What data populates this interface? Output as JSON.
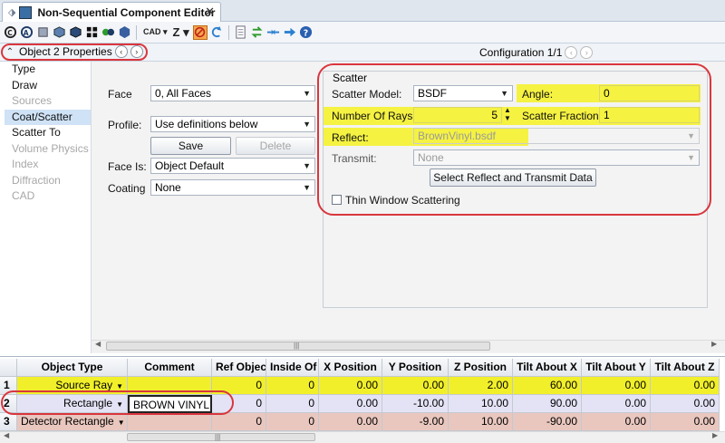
{
  "window": {
    "tab_title": "Non-Sequential Component Editor",
    "close_glyph": "✕",
    "pin_glyph": "⬗"
  },
  "toolbar": {
    "items": [
      "refresh-icon",
      "layout-icon",
      "object-icon",
      "cube-icon",
      "cube-dark-icon",
      "grid-icon",
      "sphere-icon",
      "hexagon-icon"
    ],
    "cad_label": "CAD",
    "z_label": "Z",
    "colors": {
      "accent": "#1d3a66",
      "stop": "#e8731a",
      "arrow": "#2a7fd0",
      "green": "#2e9b2e"
    }
  },
  "properties": {
    "title": "Object 2 Properties",
    "configuration": "Configuration 1/1"
  },
  "nav": {
    "items": [
      {
        "label": "Type",
        "state": "normal"
      },
      {
        "label": "Draw",
        "state": "normal"
      },
      {
        "label": "Sources",
        "state": "disabled"
      },
      {
        "label": "Coat/Scatter",
        "state": "selected"
      },
      {
        "label": "Scatter To",
        "state": "normal"
      },
      {
        "label": "Volume Physics",
        "state": "disabled"
      },
      {
        "label": "Index",
        "state": "disabled"
      },
      {
        "label": "Diffraction",
        "state": "disabled"
      },
      {
        "label": "CAD",
        "state": "disabled"
      }
    ]
  },
  "form": {
    "face_label": "Face",
    "face_value": "0, All Faces",
    "profile_label": "Profile:",
    "profile_value": "Use definitions below",
    "save_label": "Save",
    "delete_label": "Delete",
    "face_is_label": "Face Is:",
    "face_is_value": "Object Default",
    "coating_label": "Coating",
    "coating_value": "None"
  },
  "scatter": {
    "group_title": "Scatter",
    "model_label": "Scatter Model:",
    "model_value": "BSDF",
    "angle_label": "Angle:",
    "angle_value": "0",
    "rays_label": "Number Of Rays:",
    "rays_value": "5",
    "fraction_label": "Scatter Fraction",
    "fraction_value": "1",
    "reflect_label": "Reflect:",
    "reflect_value": "BrownVinyl.bsdf",
    "transmit_label": "Transmit:",
    "transmit_value": "None",
    "select_data_label": "Select Reflect and Transmit Data",
    "thin_window_label": "Thin Window Scattering",
    "thin_window_checked": false,
    "highlight_color": "#f5f242"
  },
  "grid": {
    "headers": [
      "Object Type",
      "Comment",
      "Ref Object",
      "Inside Of",
      "X Position",
      "Y Position",
      "Z Position",
      "Tilt About X",
      "Tilt About Y",
      "Tilt About Z"
    ],
    "rows": [
      {
        "num": "1",
        "type": "Source Ray",
        "comment": "",
        "ref": "0",
        "inside": "0",
        "x": "0.00",
        "y": "0.00",
        "z": "2.00",
        "tx": "60.00",
        "ty": "0.00",
        "tz": "0.00"
      },
      {
        "num": "2",
        "type": "Rectangle",
        "comment": "BROWN VINYL...",
        "ref": "0",
        "inside": "0",
        "x": "0.00",
        "y": "-10.00",
        "z": "10.00",
        "tx": "90.00",
        "ty": "0.00",
        "tz": "0.00"
      },
      {
        "num": "3",
        "type": "Detector Rectangle",
        "comment": "",
        "ref": "0",
        "inside": "0",
        "x": "0.00",
        "y": "-9.00",
        "z": "10.00",
        "tx": "-90.00",
        "ty": "0.00",
        "tz": "0.00"
      }
    ],
    "row_colors": [
      "#f1ef2a",
      "#e4e3f5",
      "#e9c7bf"
    ]
  },
  "annotation_color": "#d9363e"
}
